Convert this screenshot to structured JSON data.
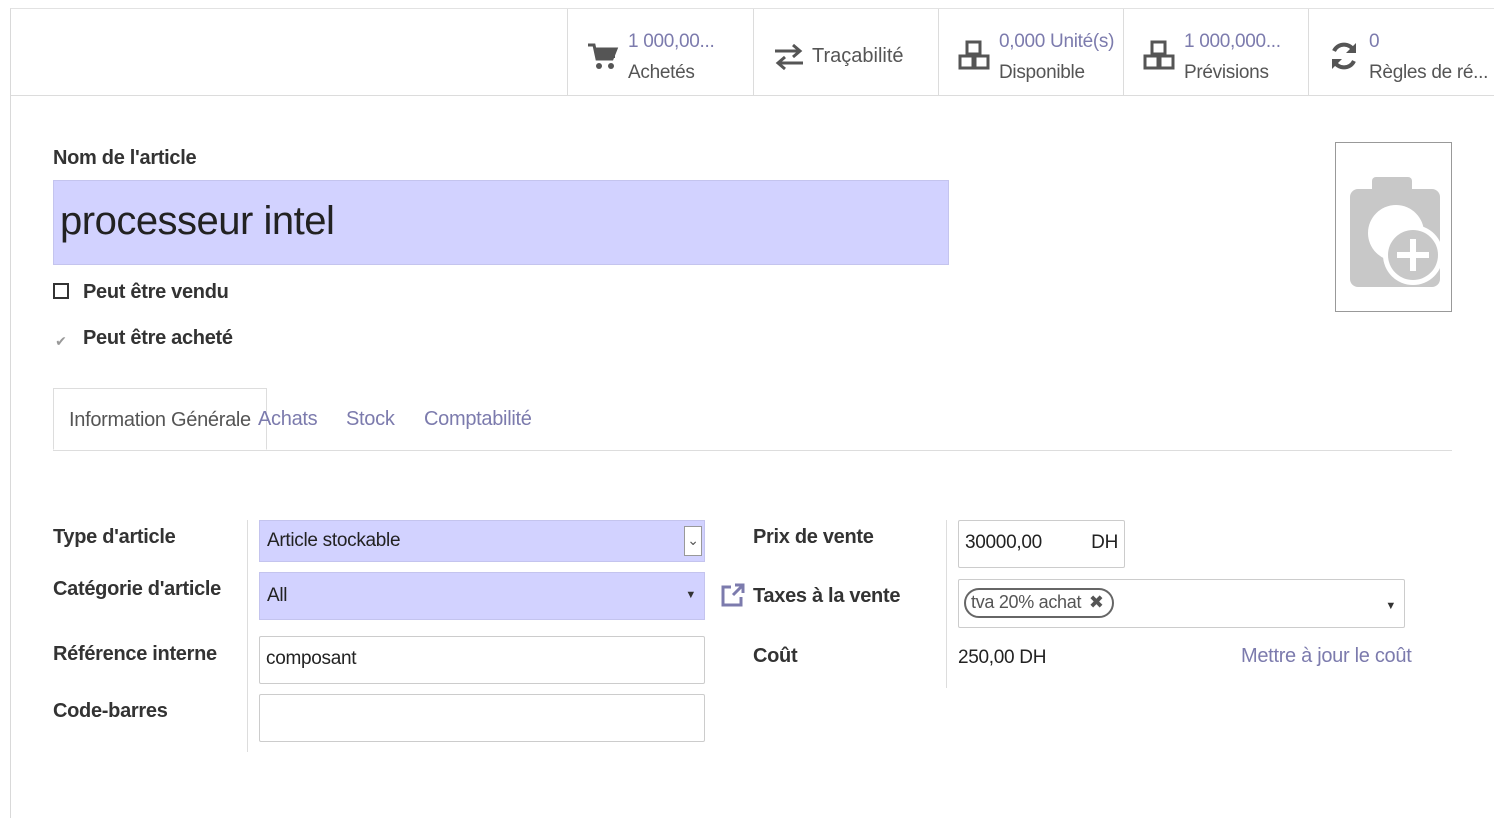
{
  "smart_buttons": {
    "purchased": {
      "value": "1 000,00...",
      "label": "Achetés",
      "icon": "cart-icon"
    },
    "traceability": {
      "label": "Traçabilité",
      "icon": "exchange-arrows-icon"
    },
    "available": {
      "value": "0,000 Unité(s)",
      "label": "Disponible",
      "icon": "cubes-icon"
    },
    "forecast": {
      "value": "1 000,000...",
      "label": "Prévisions",
      "icon": "cubes-icon"
    },
    "reorder_rules": {
      "value": "0",
      "label": "Règles de ré...",
      "icon": "refresh-icon"
    }
  },
  "form": {
    "name_label": "Nom de l'article",
    "name_value": "processeur intel",
    "can_be_sold_label": "Peut être vendu",
    "can_be_sold": false,
    "can_be_purchased_label": "Peut être acheté",
    "can_be_purchased": true
  },
  "tabs": [
    {
      "label": "Information Générale",
      "active": true
    },
    {
      "label": "Achats",
      "active": false
    },
    {
      "label": "Stock",
      "active": false
    },
    {
      "label": "Comptabilité",
      "active": false
    }
  ],
  "general": {
    "type_label": "Type d'article",
    "type_value": "Article stockable",
    "category_label": "Catégorie d'article",
    "category_value": "All",
    "internal_ref_label": "Référence interne",
    "internal_ref_value": "composant",
    "barcode_label": "Code-barres",
    "barcode_value": "",
    "sale_price_label": "Prix de vente",
    "sale_price_value": "30000,00",
    "currency": "DH",
    "sale_taxes_label": "Taxes à la vente",
    "sale_tax_tag": "tva 20% achat",
    "cost_label": "Coût",
    "cost_value": "250,00 DH",
    "update_cost_link": "Mettre à jour le coût"
  },
  "colors": {
    "accent": "#7c7bad",
    "required_field": "#d2d2ff"
  }
}
